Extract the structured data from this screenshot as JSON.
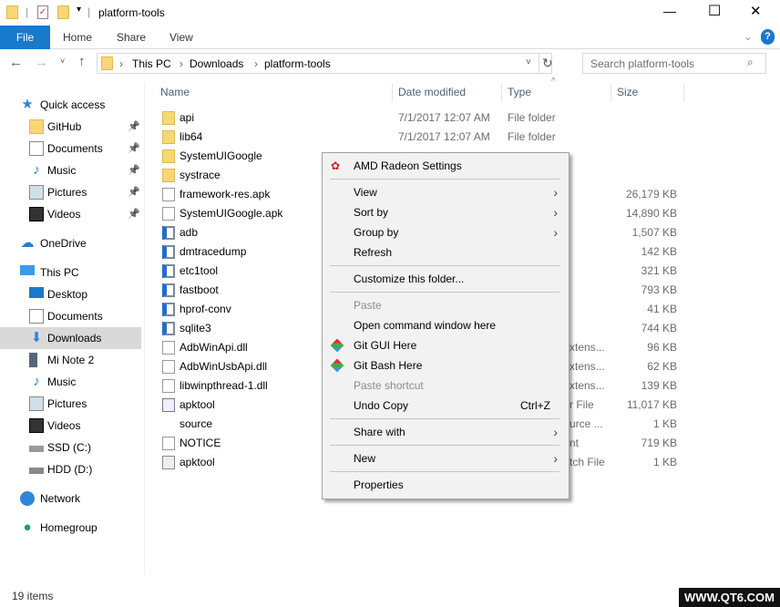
{
  "window": {
    "title": "platform-tools",
    "minimize": "—",
    "maximize": "☐",
    "close": "✕"
  },
  "ribbon": {
    "tabs": [
      "File",
      "Home",
      "Share",
      "View"
    ],
    "help": "?",
    "expand": "⌄"
  },
  "address": {
    "crumbs": [
      "This PC",
      "Downloads",
      "platform-tools"
    ],
    "search_placeholder": "Search platform-tools"
  },
  "columns": [
    "Name",
    "Date modified",
    "Type",
    "Size"
  ],
  "sidebar": [
    {
      "label": "Quick access",
      "icon": "star",
      "level": 0
    },
    {
      "label": "GitHub",
      "icon": "folder",
      "level": 1,
      "pinned": true
    },
    {
      "label": "Documents",
      "icon": "document",
      "level": 1,
      "pinned": true
    },
    {
      "label": "Music",
      "icon": "music",
      "level": 1,
      "pinned": true
    },
    {
      "label": "Pictures",
      "icon": "pictures",
      "level": 1,
      "pinned": true
    },
    {
      "label": "Videos",
      "icon": "videos",
      "level": 1,
      "pinned": true
    },
    {
      "label": "OneDrive",
      "icon": "cloud",
      "level": 0
    },
    {
      "label": "This PC",
      "icon": "computer",
      "level": 0
    },
    {
      "label": "Desktop",
      "icon": "desktop",
      "level": 1
    },
    {
      "label": "Documents",
      "icon": "document",
      "level": 1
    },
    {
      "label": "Downloads",
      "icon": "download",
      "level": 1,
      "selected": true
    },
    {
      "label": "Mi Note 2",
      "icon": "phone",
      "level": 1
    },
    {
      "label": "Music",
      "icon": "music",
      "level": 1
    },
    {
      "label": "Pictures",
      "icon": "pictures",
      "level": 1
    },
    {
      "label": "Videos",
      "icon": "videos",
      "level": 1
    },
    {
      "label": "SSD (C:)",
      "icon": "drive-windows",
      "level": 1
    },
    {
      "label": "HDD (D:)",
      "icon": "drive",
      "level": 1
    },
    {
      "label": "Network",
      "icon": "network",
      "level": 0
    },
    {
      "label": "Homegroup",
      "icon": "homegroup",
      "level": 0
    }
  ],
  "files": [
    {
      "name": "api",
      "date": "7/1/2017 12:07 AM",
      "type": "File folder",
      "size": "",
      "icon": "folder"
    },
    {
      "name": "lib64",
      "date": "7/1/2017 12:07 AM",
      "type": "File folder",
      "size": "",
      "icon": "folder"
    },
    {
      "name": "SystemUIGoogle",
      "date": "",
      "type": "",
      "size": "",
      "icon": "folder"
    },
    {
      "name": "systrace",
      "date": "",
      "type": "",
      "size": "",
      "icon": "folder"
    },
    {
      "name": "framework-res.apk",
      "date": "",
      "type": "",
      "size": "26,179 KB",
      "icon": "file"
    },
    {
      "name": "SystemUIGoogle.apk",
      "date": "",
      "type": "",
      "size": "14,890 KB",
      "icon": "file"
    },
    {
      "name": "adb",
      "date": "",
      "type": "",
      "size": "1,507 KB",
      "icon": "exe"
    },
    {
      "name": "dmtracedump",
      "date": "",
      "type": "",
      "size": "142 KB",
      "icon": "exe"
    },
    {
      "name": "etc1tool",
      "date": "",
      "type": "",
      "size": "321 KB",
      "icon": "exe"
    },
    {
      "name": "fastboot",
      "date": "",
      "type": "",
      "size": "793 KB",
      "icon": "exe"
    },
    {
      "name": "hprof-conv",
      "date": "",
      "type": "",
      "size": "41 KB",
      "icon": "exe"
    },
    {
      "name": "sqlite3",
      "date": "",
      "type": "",
      "size": "744 KB",
      "icon": "exe"
    },
    {
      "name": "AdbWinApi.dll",
      "date": "",
      "type": "xtens...",
      "size": "96 KB",
      "icon": "dll"
    },
    {
      "name": "AdbWinUsbApi.dll",
      "date": "",
      "type": "xtens...",
      "size": "62 KB",
      "icon": "dll"
    },
    {
      "name": "libwinpthread-1.dll",
      "date": "",
      "type": "xtens...",
      "size": "139 KB",
      "icon": "dll"
    },
    {
      "name": "apktool",
      "date": "",
      "type": "r File",
      "size": "11,017 KB",
      "icon": "jar"
    },
    {
      "name": "source",
      "date": "",
      "type": "urce ...",
      "size": "1 KB",
      "icon": "vscode"
    },
    {
      "name": "NOTICE",
      "date": "",
      "type": "nt",
      "size": "719 KB",
      "icon": "text"
    },
    {
      "name": "apktool",
      "date": "",
      "type": "tch File",
      "size": "1 KB",
      "icon": "batch"
    }
  ],
  "context_menu": [
    {
      "label": "AMD Radeon Settings",
      "icon": "amd"
    },
    {
      "sep": true
    },
    {
      "label": "View",
      "submenu": true
    },
    {
      "label": "Sort by",
      "submenu": true
    },
    {
      "label": "Group by",
      "submenu": true
    },
    {
      "label": "Refresh"
    },
    {
      "sep": true
    },
    {
      "label": "Customize this folder..."
    },
    {
      "sep": true
    },
    {
      "label": "Paste",
      "disabled": true
    },
    {
      "label": "Open command window here"
    },
    {
      "label": "Git GUI Here",
      "icon": "git"
    },
    {
      "label": "Git Bash Here",
      "icon": "git"
    },
    {
      "label": "Paste shortcut",
      "disabled": true
    },
    {
      "label": "Undo Copy",
      "shortcut": "Ctrl+Z"
    },
    {
      "sep": true
    },
    {
      "label": "Share with",
      "submenu": true
    },
    {
      "sep": true
    },
    {
      "label": "New",
      "submenu": true
    },
    {
      "sep": true
    },
    {
      "label": "Properties"
    }
  ],
  "status": {
    "count": "19 items"
  },
  "watermark": "WWW.QT6.COM",
  "colors": {
    "accent": "#1979ca",
    "selected": "#d9d9d9"
  }
}
